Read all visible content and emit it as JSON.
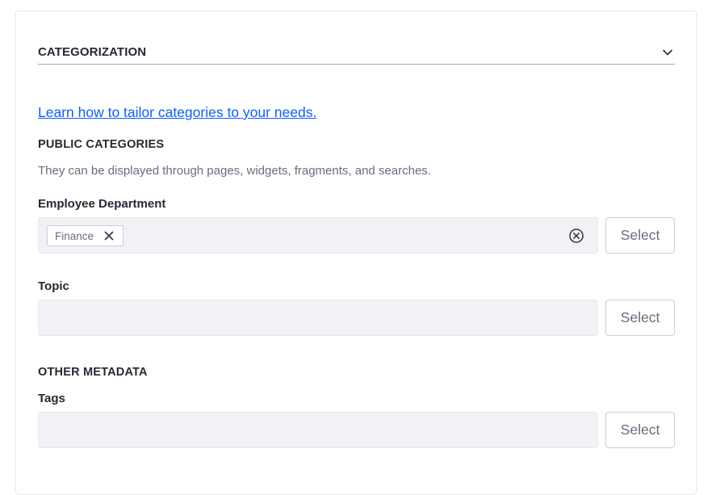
{
  "panel": {
    "title": "CATEGORIZATION",
    "toggle_icon": "chevron-down-icon"
  },
  "help_link": "Learn how to tailor categories to your needs.",
  "public_categories": {
    "title": "PUBLIC CATEGORIES",
    "description": "They can be displayed through pages, widgets, fragments, and searches.",
    "fields": [
      {
        "label": "Employee Department",
        "tags": [
          "Finance"
        ],
        "select_label": "Select"
      },
      {
        "label": "Topic",
        "tags": [],
        "select_label": "Select"
      }
    ]
  },
  "other_metadata": {
    "title": "OTHER METADATA",
    "tags_field": {
      "label": "Tags",
      "tags": [],
      "select_label": "Select"
    }
  },
  "colors": {
    "link": "#0b5fff",
    "input_bg": "#f1f2f5",
    "border": "#cdced9",
    "text": "#272833",
    "muted_text": "#6b6c7e"
  }
}
